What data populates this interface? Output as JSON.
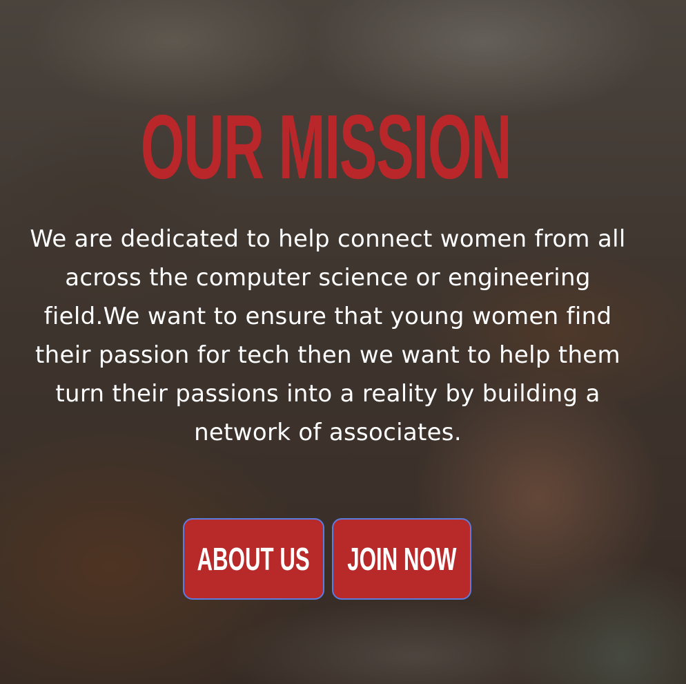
{
  "mission": {
    "title": "OUR MISSION",
    "body": "We are dedicated to help connect women from all across the computer science or engineering field.We want to ensure that young women find their passion for tech then we want to help them turn their passions into a reality by building a network of associates."
  },
  "buttons": {
    "about_label": "ABOUT US",
    "join_label": "JOIN NOW"
  },
  "colors": {
    "accent": "#b8292a",
    "button_border": "#5b7de0",
    "text": "#ffffff"
  }
}
